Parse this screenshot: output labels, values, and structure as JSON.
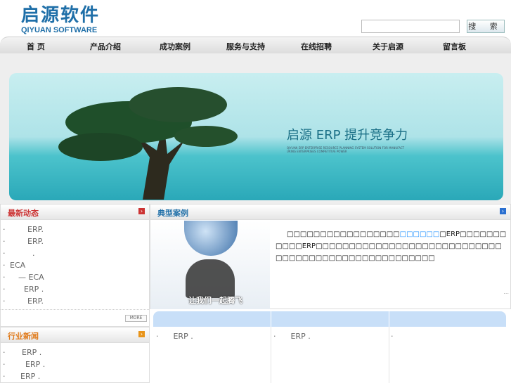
{
  "logo": {
    "cn": "启源软件",
    "en": "QIYUAN SOFTWARE"
  },
  "search": {
    "value": "",
    "button": "搜 索"
  },
  "nav": [
    "首 页",
    "产品介绍",
    "成功案例",
    "服务与支持",
    "在线招聘",
    "关于启源",
    "留言板"
  ],
  "banner": {
    "title": "启源 ERP 提升竞争力",
    "subtitle": "QIYUAN ERP ENTERPRISE RESOURCE PLANNING SYSTEM SOLUTION FOR MANUFACTURING ENTERPRISES COMPETITIVE POWER"
  },
  "news": {
    "title": "最新动态",
    "items": [
      "ERP.",
      "ERP.",
      ".",
      "ECA",
      "— ECA",
      "ERP .",
      "ERP."
    ],
    "more": "MORE"
  },
  "industry": {
    "title": "行业新闻",
    "items": [
      "ERP .",
      "ERP .",
      "ERP ."
    ]
  },
  "cases": {
    "title": "典型案例",
    "image_caption": "让我们一起腾飞",
    "text_a": "□□□□□□□□□□□□□□□□□",
    "link": "□□□□□□",
    "text_b": "□ERP□□□□□□□□□□□ERP□□□□□□□□□□□□□□□□□",
    "text_c": "□□□□□□□□□□□□□□□□□□□□□□□□□□□□□□□□□□□",
    "ellipsis": "..."
  },
  "bottom": {
    "col1": "ERP .",
    "col2": "ERP .",
    "col3": ""
  },
  "colors": {
    "brand": "#1f6fa8",
    "news_title": "#cc3333",
    "industry_title": "#e07a1a",
    "case_title": "#1f6fa8"
  }
}
